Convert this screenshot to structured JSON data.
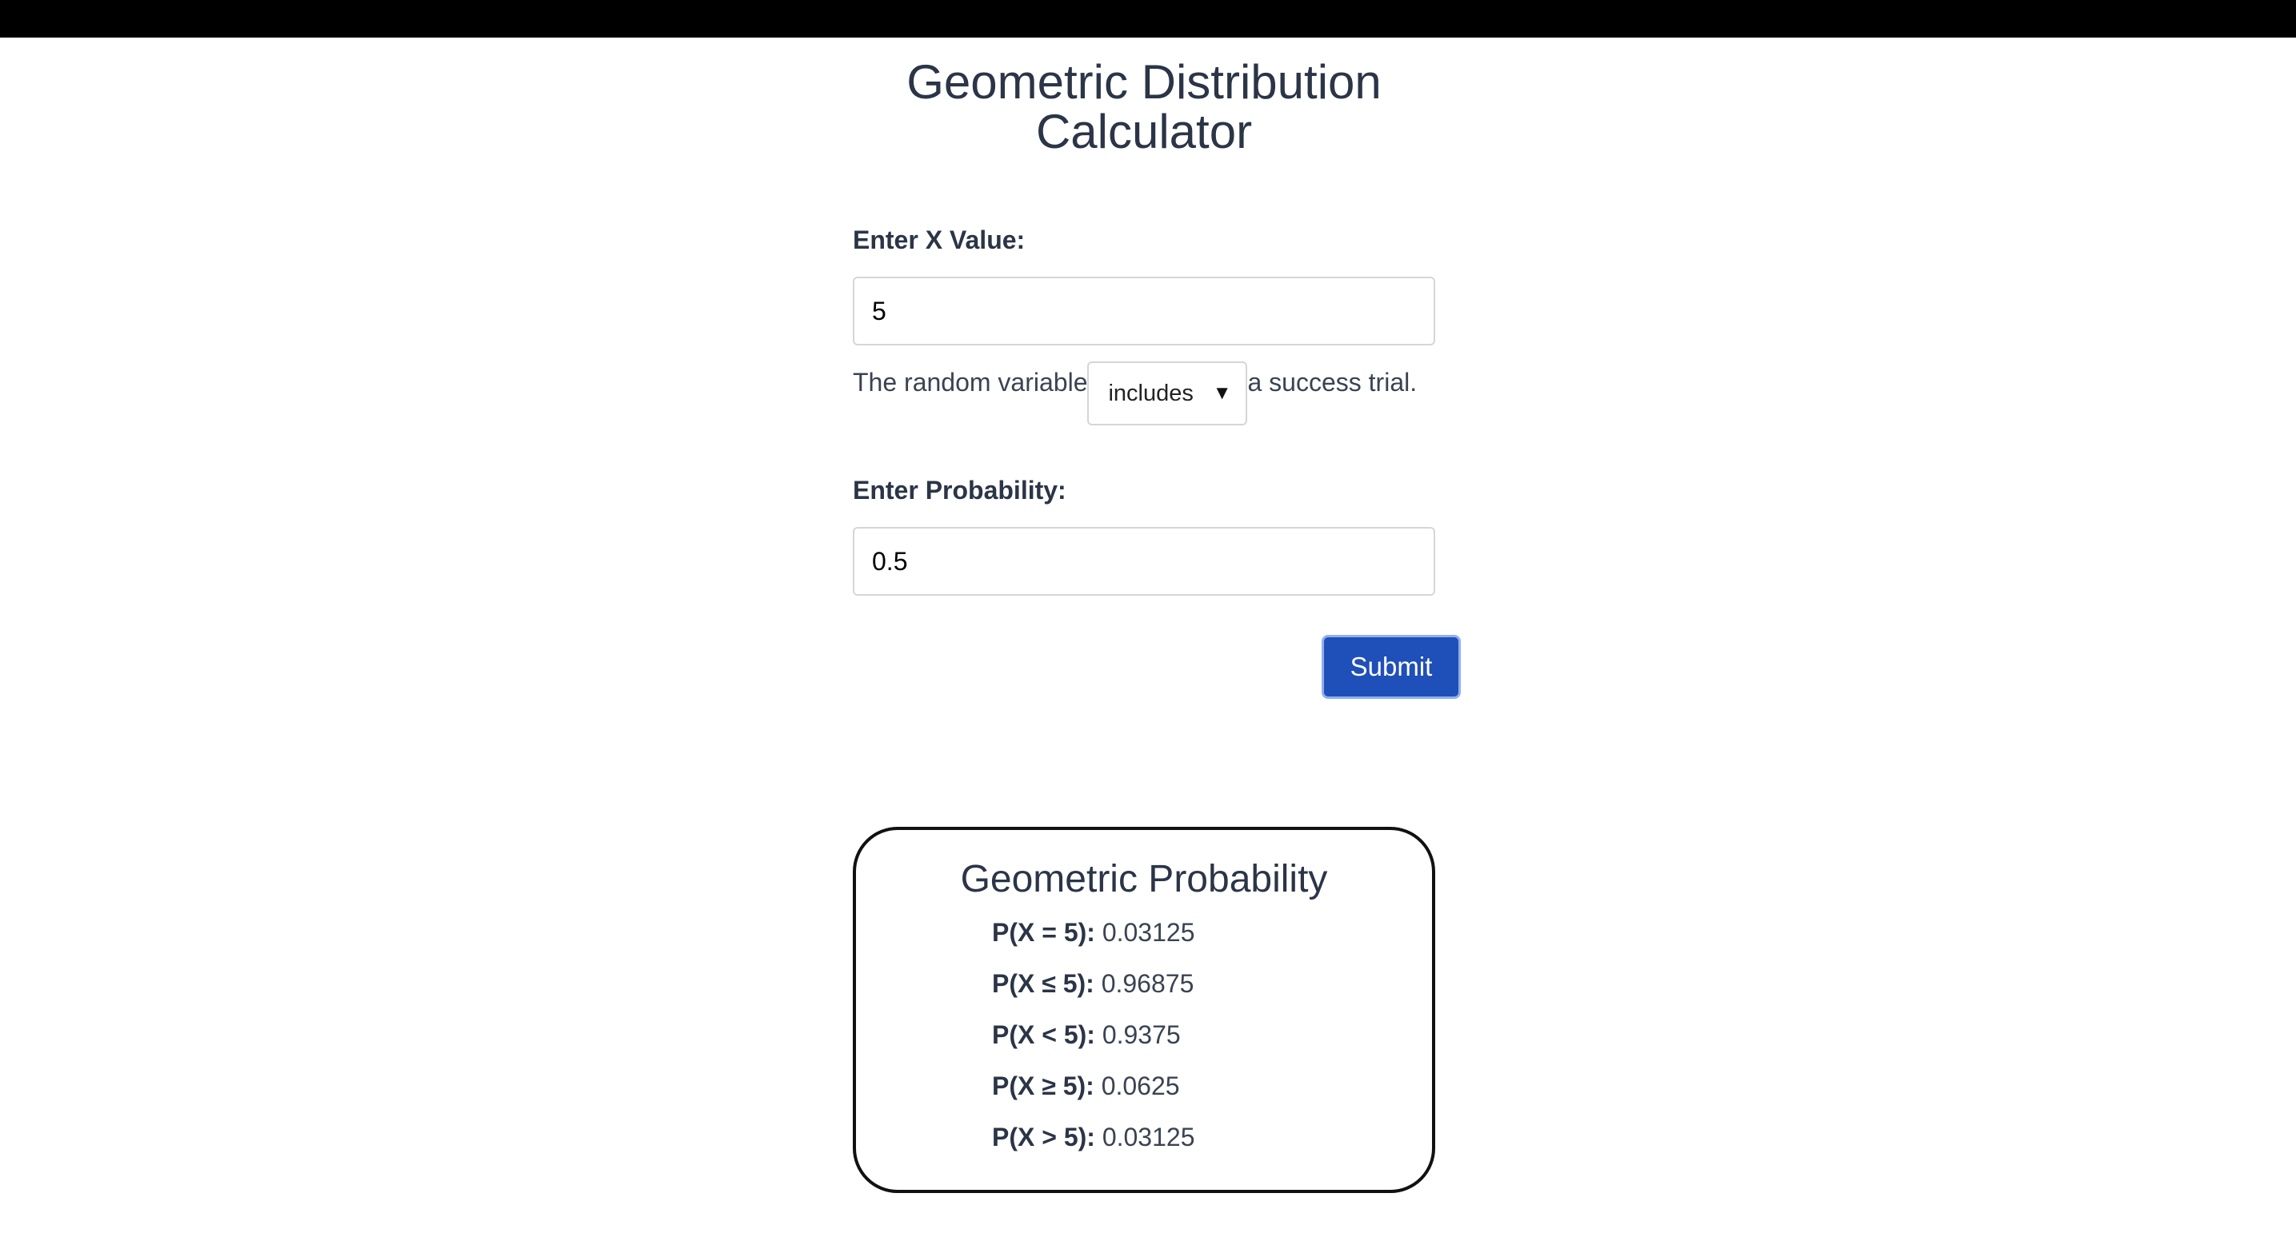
{
  "page": {
    "title_line1": "Geometric Distribution",
    "title_line2": "Calculator"
  },
  "form": {
    "x_label": "Enter X Value:",
    "x_value": "5",
    "sentence_prefix": "The random variable",
    "select_value": "includes",
    "sentence_suffix": "a success trial.",
    "prob_label": "Enter Probability:",
    "prob_value": "0.5",
    "submit_label": "Submit"
  },
  "result": {
    "title": "Geometric Probability",
    "rows": [
      {
        "label": "P(X = 5):",
        "value": "0.03125"
      },
      {
        "label": "P(X ≤ 5):",
        "value": "0.96875"
      },
      {
        "label": "P(X < 5):",
        "value": "0.9375"
      },
      {
        "label": "P(X ≥ 5):",
        "value": "0.0625"
      },
      {
        "label": "P(X > 5):",
        "value": "0.03125"
      }
    ]
  },
  "colors": {
    "heading": "#2b3547",
    "button": "#1f4fb8",
    "topbar": "#000000"
  },
  "icons": {
    "select_caret": "caret-down-icon"
  }
}
